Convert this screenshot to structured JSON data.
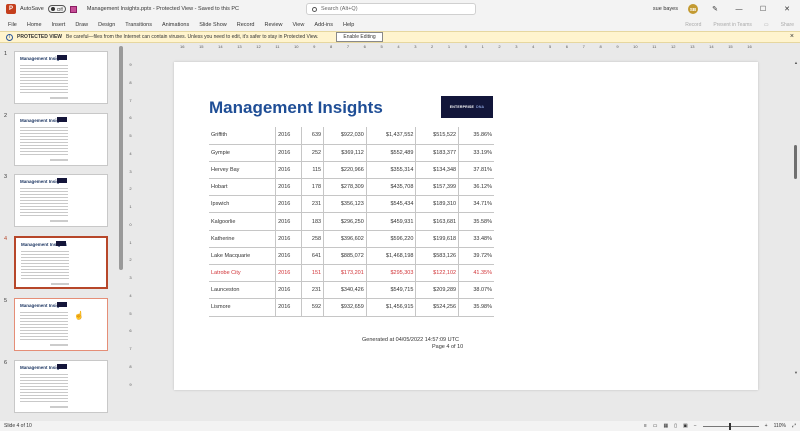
{
  "titlebar": {
    "app_icon": "P",
    "autosave_label": "AutoSave",
    "autosave_state": "Off",
    "document_title": "Management Insights.pptx  -  Protected View  -  Saved to this PC",
    "search_placeholder": "Search (Alt+Q)",
    "user_name": "sue bayes",
    "user_initials": "SB",
    "window_buttons": [
      "—",
      "☐",
      "✕"
    ]
  },
  "menu": {
    "items": [
      "File",
      "Home",
      "Insert",
      "Draw",
      "Design",
      "Transitions",
      "Animations",
      "Slide Show",
      "Record",
      "Review",
      "View",
      "Add-ins",
      "Help"
    ],
    "right": [
      "Record",
      "Present in Teams",
      "Share"
    ]
  },
  "infobar": {
    "label": "PROTECTED VIEW",
    "message": "Be careful—files from the Internet can contain viruses. Unless you need to edit, it's safer to stay in Protected View.",
    "enable_button": "Enable Editing"
  },
  "thumbnails": [
    {
      "num": "1",
      "title": "Management Insights"
    },
    {
      "num": "2",
      "title": "Management Insights"
    },
    {
      "num": "3",
      "title": "Management Insights"
    },
    {
      "num": "4",
      "title": "Management Insights"
    },
    {
      "num": "5",
      "title": "Management Insights"
    },
    {
      "num": "6",
      "title": "Management Insights"
    }
  ],
  "ruler": {
    "horizontal": [
      "16",
      "15",
      "14",
      "13",
      "12",
      "11",
      "10",
      "9",
      "8",
      "7",
      "6",
      "5",
      "4",
      "3",
      "2",
      "1",
      "0",
      "1",
      "2",
      "3",
      "4",
      "5",
      "6",
      "7",
      "8",
      "9",
      "10",
      "11",
      "12",
      "13",
      "14",
      "15",
      "16"
    ],
    "vertical": [
      "9",
      "8",
      "7",
      "6",
      "5",
      "4",
      "3",
      "2",
      "1",
      "0",
      "1",
      "2",
      "3",
      "4",
      "5",
      "6",
      "7",
      "8",
      "9"
    ]
  },
  "slide": {
    "title": "Management Insights",
    "logo_main": "ENTERPRISE",
    "logo_sub": "DNA",
    "rows": [
      [
        "Griffith",
        "2016",
        "639",
        "$922,030",
        "$1,437,552",
        "$515,522",
        "35.86%"
      ],
      [
        "Gympie",
        "2016",
        "252",
        "$369,112",
        "$552,489",
        "$183,377",
        "33.19%"
      ],
      [
        "Hervey Bay",
        "2016",
        "115",
        "$220,966",
        "$355,314",
        "$134,348",
        "37.81%"
      ],
      [
        "Hobart",
        "2016",
        "178",
        "$278,309",
        "$435,708",
        "$157,399",
        "36.12%"
      ],
      [
        "Ipswich",
        "2016",
        "231",
        "$356,123",
        "$545,434",
        "$189,310",
        "34.71%"
      ],
      [
        "Kalgoorlie",
        "2016",
        "183",
        "$296,250",
        "$459,931",
        "$163,681",
        "35.58%"
      ],
      [
        "Katherine",
        "2016",
        "258",
        "$396,602",
        "$596,220",
        "$199,618",
        "33.48%"
      ],
      [
        "Lake Macquarie",
        "2016",
        "641",
        "$885,072",
        "$1,468,198",
        "$583,126",
        "39.72%"
      ],
      [
        "Latrobe City",
        "2016",
        "151",
        "$173,201",
        "$295,303",
        "$122,102",
        "41.35%"
      ],
      [
        "Launceston",
        "2016",
        "231",
        "$340,426",
        "$549,715",
        "$209,289",
        "38.07%"
      ],
      [
        "Lismore",
        "2016",
        "592",
        "$932,659",
        "$1,456,915",
        "$524,256",
        "35.98%"
      ]
    ],
    "highlight_row": "Latrobe City",
    "highlight_color": "#d13438",
    "generated": "Generated at 04/05/2022 14:57:09 UTC",
    "page": "Page 4 of 10"
  },
  "status": {
    "slide_info": "Slide 4 of 10",
    "zoom": "110%"
  },
  "colors": {
    "accent": "#b7472a",
    "title_blue": "#1f4e96",
    "logo_bg": "#12163a",
    "infobar_bg": "#fff4ce"
  }
}
